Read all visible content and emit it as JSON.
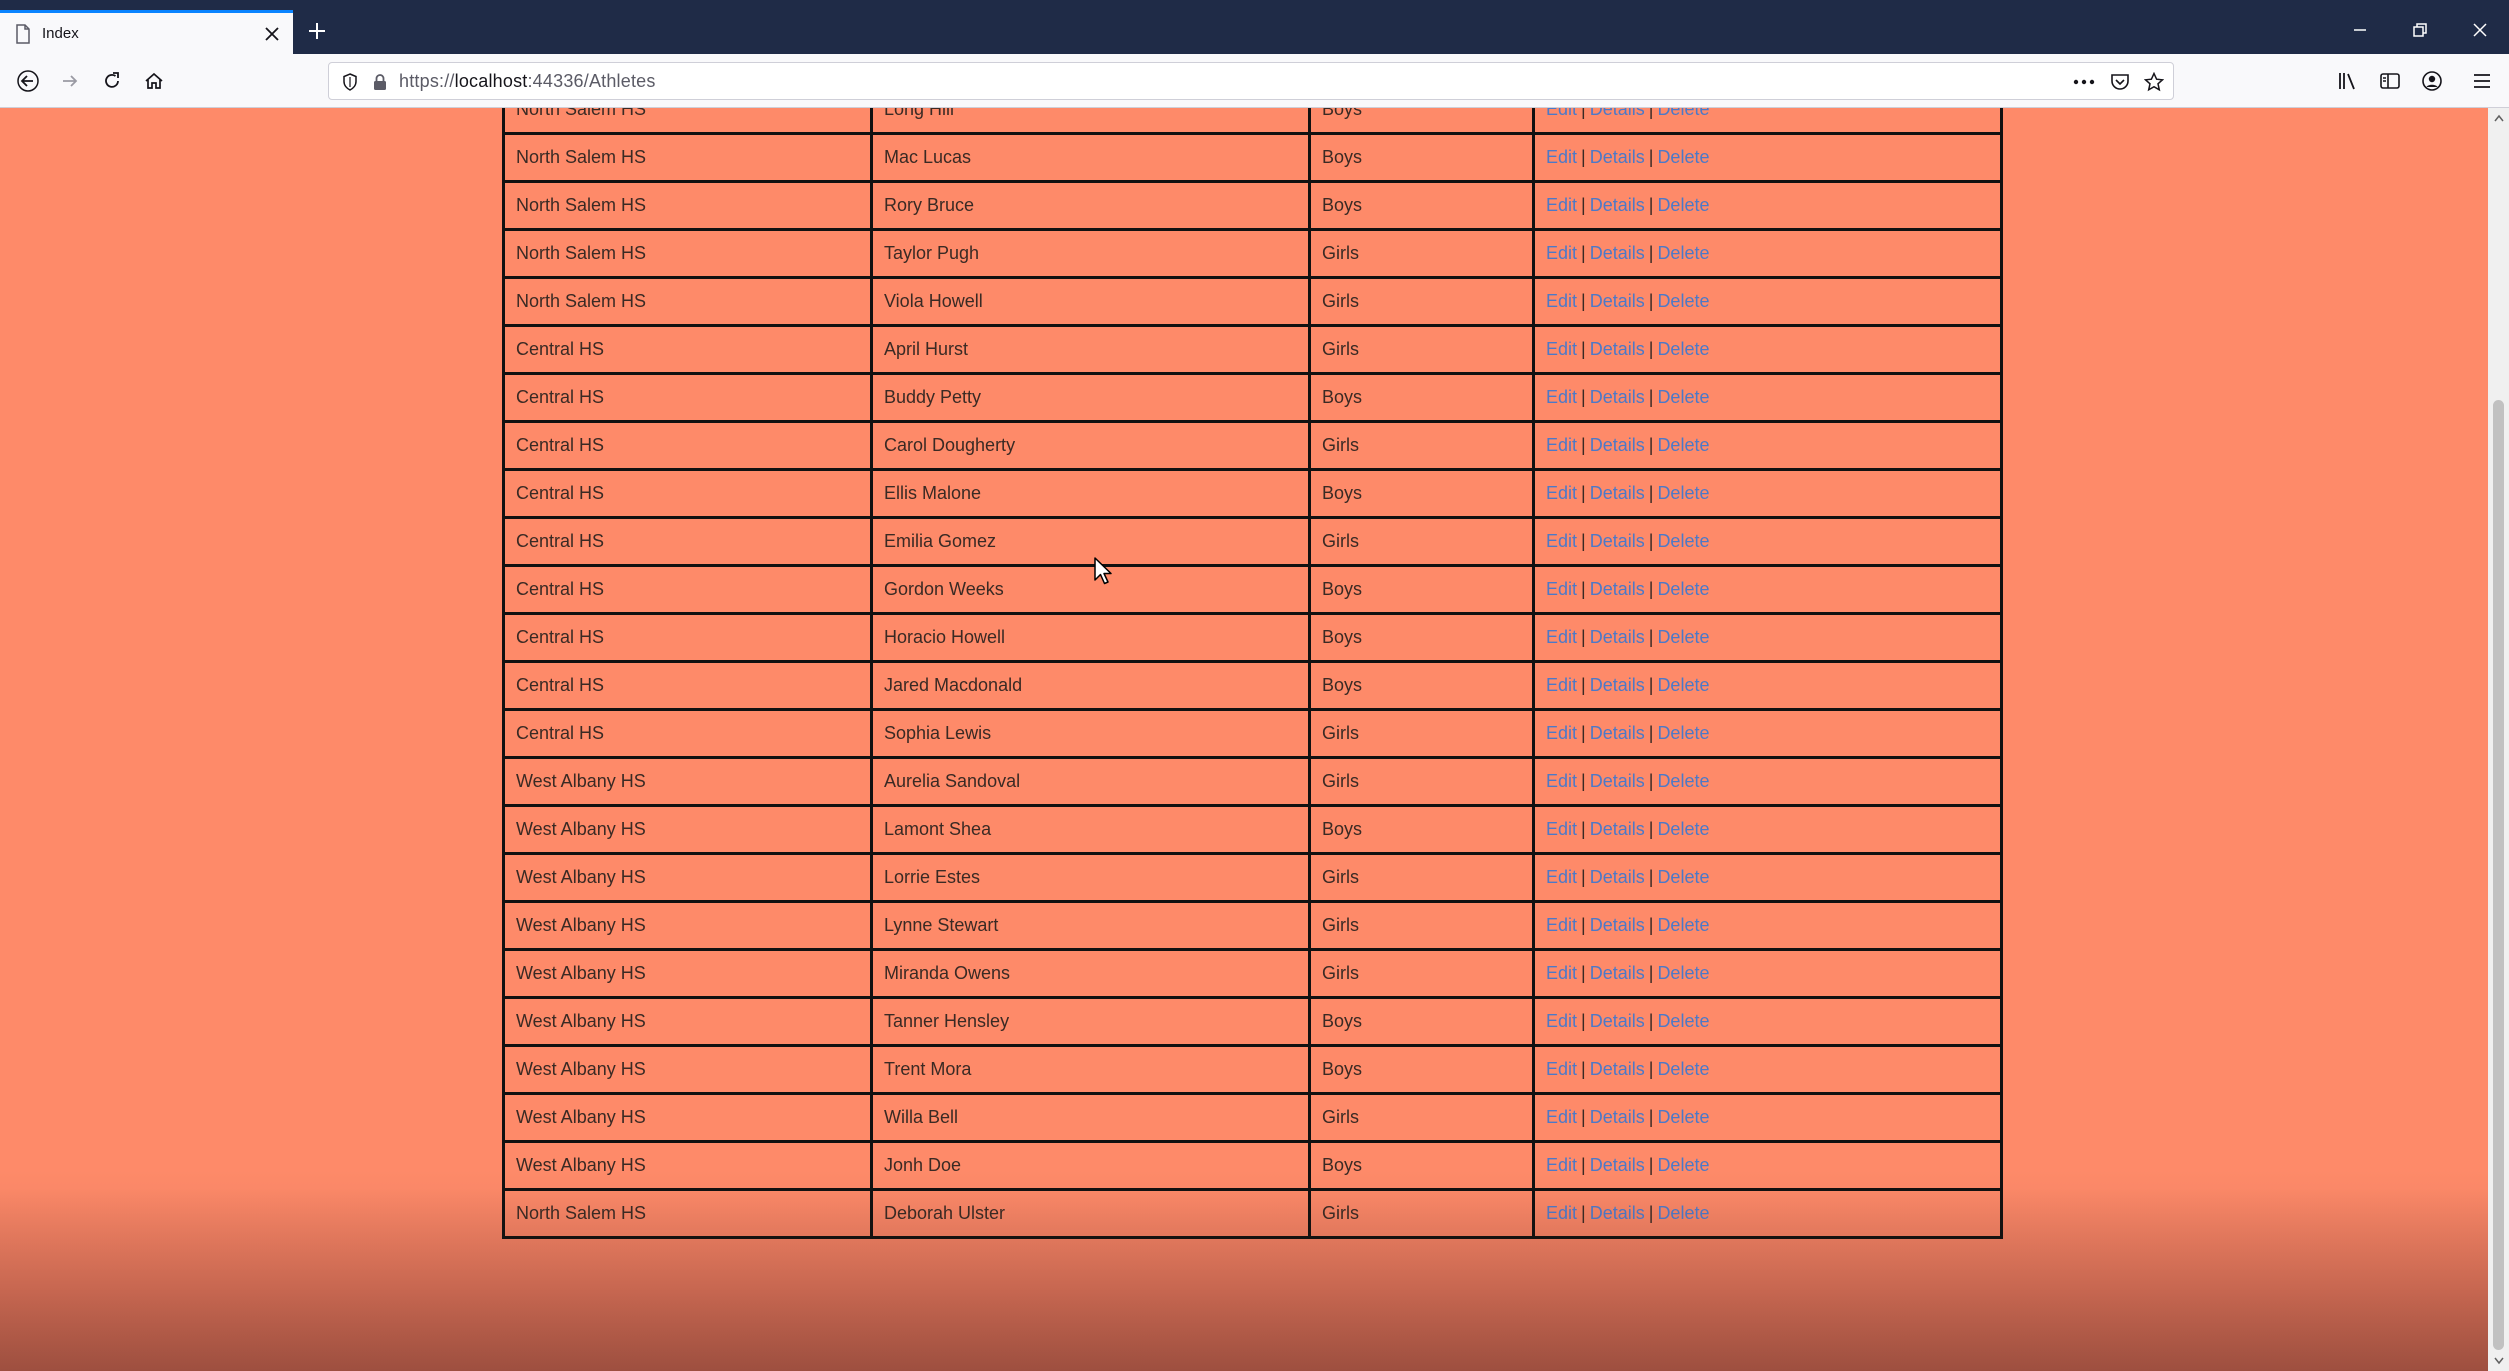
{
  "browser": {
    "tab_title": "Index",
    "url_prefix": "https://",
    "url_host": "localhost",
    "url_rest": ":44336/Athletes"
  },
  "table": {
    "action_labels": {
      "edit": "Edit",
      "details": "Details",
      "delete": "Delete",
      "separator": "|"
    },
    "rows": [
      {
        "school": "North Salem HS",
        "name": "Long Hill",
        "gender": "Boys"
      },
      {
        "school": "North Salem HS",
        "name": "Mac Lucas",
        "gender": "Boys"
      },
      {
        "school": "North Salem HS",
        "name": "Rory Bruce",
        "gender": "Boys"
      },
      {
        "school": "North Salem HS",
        "name": "Taylor Pugh",
        "gender": "Girls"
      },
      {
        "school": "North Salem HS",
        "name": "Viola Howell",
        "gender": "Girls"
      },
      {
        "school": "Central HS",
        "name": "April Hurst",
        "gender": "Girls"
      },
      {
        "school": "Central HS",
        "name": "Buddy Petty",
        "gender": "Boys"
      },
      {
        "school": "Central HS",
        "name": "Carol Dougherty",
        "gender": "Girls"
      },
      {
        "school": "Central HS",
        "name": "Ellis Malone",
        "gender": "Boys"
      },
      {
        "school": "Central HS",
        "name": "Emilia Gomez",
        "gender": "Girls"
      },
      {
        "school": "Central HS",
        "name": "Gordon Weeks",
        "gender": "Boys"
      },
      {
        "school": "Central HS",
        "name": "Horacio Howell",
        "gender": "Boys"
      },
      {
        "school": "Central HS",
        "name": "Jared Macdonald",
        "gender": "Boys"
      },
      {
        "school": "Central HS",
        "name": "Sophia Lewis",
        "gender": "Girls"
      },
      {
        "school": "West Albany HS",
        "name": "Aurelia Sandoval",
        "gender": "Girls"
      },
      {
        "school": "West Albany HS",
        "name": "Lamont Shea",
        "gender": "Boys"
      },
      {
        "school": "West Albany HS",
        "name": "Lorrie Estes",
        "gender": "Girls"
      },
      {
        "school": "West Albany HS",
        "name": "Lynne Stewart",
        "gender": "Girls"
      },
      {
        "school": "West Albany HS",
        "name": "Miranda Owens",
        "gender": "Girls"
      },
      {
        "school": "West Albany HS",
        "name": "Tanner Hensley",
        "gender": "Boys"
      },
      {
        "school": "West Albany HS",
        "name": "Trent Mora",
        "gender": "Boys"
      },
      {
        "school": "West Albany HS",
        "name": "Willa Bell",
        "gender": "Girls"
      },
      {
        "school": "West Albany HS",
        "name": "Jonh Doe",
        "gender": "Boys"
      },
      {
        "school": "North Salem HS",
        "name": "Deborah Ulster",
        "gender": "Girls"
      }
    ]
  },
  "colors": {
    "page_background": "#fe8a69",
    "link": "#4c79c8",
    "titlebar": "#1f2b47"
  }
}
